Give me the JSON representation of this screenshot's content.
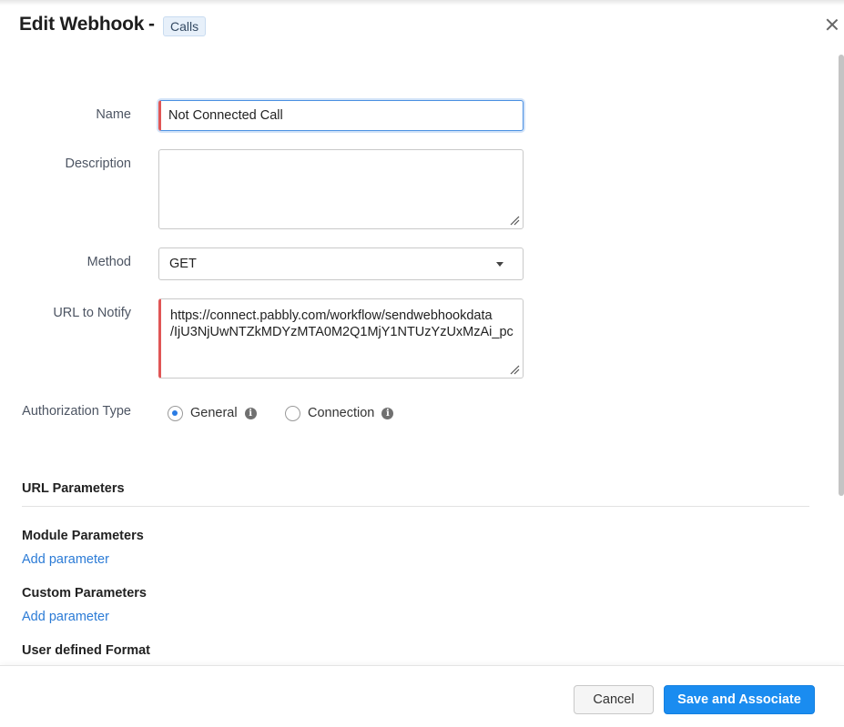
{
  "header": {
    "title": "Edit Webhook",
    "separator": "-",
    "module": "Calls"
  },
  "form": {
    "name": {
      "label": "Name",
      "value": "Not Connected Call"
    },
    "description": {
      "label": "Description",
      "value": ""
    },
    "method": {
      "label": "Method",
      "value": "GET"
    },
    "url": {
      "label": "URL to Notify",
      "value": "https://connect.pabbly.com/workflow/sendwebhookdata\n/IjU3NjUwNTZkMDYzMTA0M2Q1MjY1NTUzYzUxMzAi_pc"
    },
    "auth": {
      "label": "Authorization Type",
      "options": [
        {
          "label": "General",
          "checked": true
        },
        {
          "label": "Connection",
          "checked": false
        }
      ]
    }
  },
  "sections": {
    "url_parameters": "URL Parameters",
    "module_parameters": "Module Parameters",
    "module_add": "Add parameter",
    "custom_parameters": "Custom Parameters",
    "custom_add": "Add parameter",
    "user_defined": "User defined Format"
  },
  "footer": {
    "cancel": "Cancel",
    "save": "Save and Associate"
  },
  "icons": {
    "close": "close-icon",
    "info": "info-icon",
    "caret": "chevron-down-icon",
    "resize": "resize-grip-icon"
  },
  "colors": {
    "accent": "#1a8cf0",
    "link": "#2b7bd6",
    "required": "#e05656",
    "badge_bg": "#e7f0fa"
  }
}
